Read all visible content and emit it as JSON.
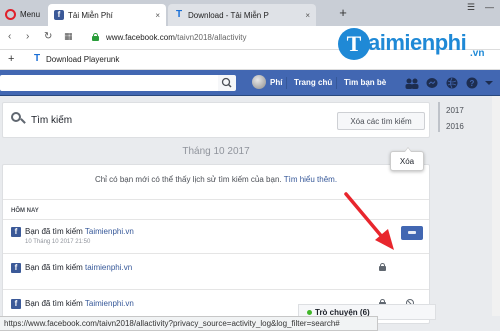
{
  "browser": {
    "menu_label": "Menu",
    "tabs": [
      {
        "label": "Tải Miễn Phí",
        "favicon": "facebook-icon",
        "close": "×"
      },
      {
        "label": "Download - Tải Miễn P",
        "favicon": "taimienphi-icon",
        "close": "×"
      }
    ],
    "new_tab": "+",
    "address": {
      "prefix": "www.facebook.com",
      "path": "/taivn2018/allactivity"
    },
    "bookmark": {
      "label": "Download Playerunk",
      "add": "+"
    },
    "status_url": "https://www.facebook.com/taivn2018/allactivity?privacy_source=activity_log&log_filter=search#"
  },
  "watermark": {
    "letter": "T",
    "text": "aimienphi",
    "tld": ".vn"
  },
  "fb_header": {
    "user": "Phí",
    "nav": [
      "Trang chủ",
      "Tìm bạn bè"
    ],
    "brand_color": "#4267b2"
  },
  "search_card": {
    "title": "Tìm kiếm",
    "clear_button": "Xóa các tìm kiếm"
  },
  "years": [
    "2017",
    "2016"
  ],
  "month_header": "Tháng 10 2017",
  "activity": {
    "notice_text": "Chỉ có bạn mới có thể thấy lịch sử tìm kiếm của bạn.",
    "notice_link": "Tìm hiểu thêm.",
    "section_label": "HÔM NAY",
    "rows": [
      {
        "text": "Bạn đã tìm kiếm ",
        "link": "Taimienphi.vn",
        "time": "10 Tháng 10 2017 21:50"
      },
      {
        "text": "Bạn đã tìm kiếm ",
        "link": "taimienphi.vn",
        "time": ""
      },
      {
        "text": "Bạn đã tìm kiếm ",
        "link": "Taimienphi.vn",
        "time": ""
      }
    ],
    "tooltip": "Xóa"
  },
  "chat": {
    "label": "Trò chuyện (6)"
  }
}
